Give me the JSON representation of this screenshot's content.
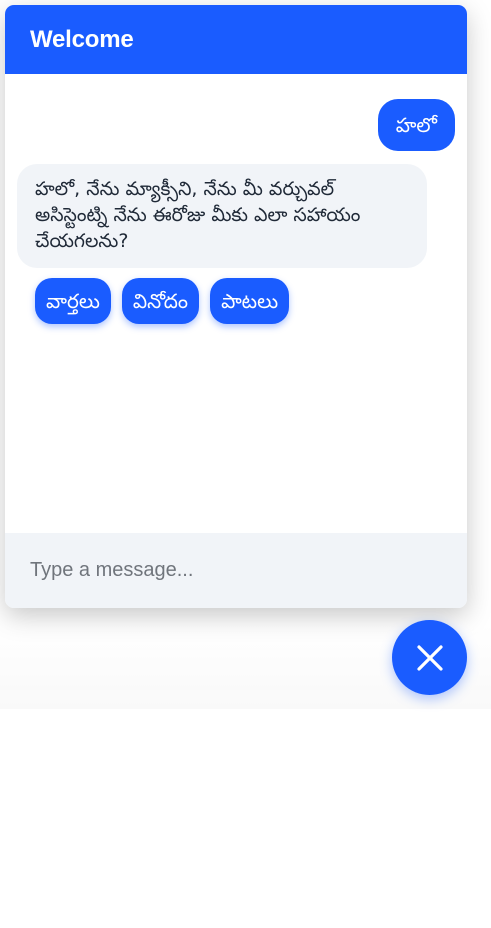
{
  "header": {
    "title": "Welcome"
  },
  "messages": [
    {
      "role": "user",
      "text": "హలో"
    },
    {
      "role": "bot",
      "text": "హలో, నేను మ్యాక్సీని, నేను మీ వర్చువల్ అసిస్టెంట్ని నేను ఈరోజు మీకు ఎలా సహాయం చేయగలను?"
    }
  ],
  "quick_replies": [
    "వార్తలు",
    "వినోదం",
    "పాటలు"
  ],
  "input": {
    "placeholder": "Type a message...",
    "value": ""
  },
  "fab": {
    "icon": "close-icon"
  },
  "colors": {
    "accent": "#1a5cff",
    "bubble_bot": "#f1f4f8",
    "input_bg": "#f1f4f8"
  }
}
